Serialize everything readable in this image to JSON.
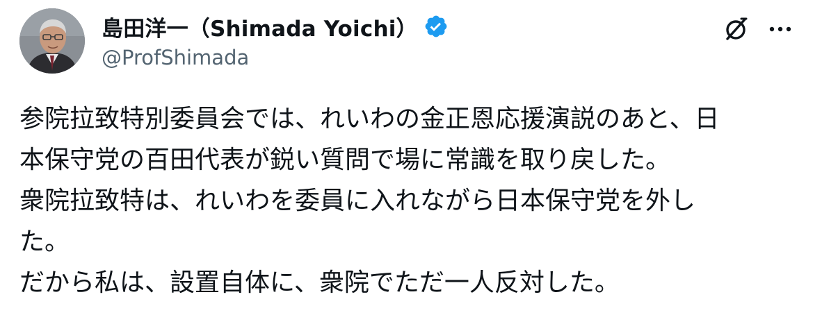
{
  "author": {
    "display_name": "島田洋一（Shimada Yoichi）",
    "handle": "@ProfShimada",
    "verified": true,
    "avatar_icon": "avatar-photo",
    "verified_icon": "verified-badge-icon"
  },
  "actions": {
    "grok_icon": "grok-icon",
    "more_icon": "more-options-icon"
  },
  "colors": {
    "text": "#0f1419",
    "secondary": "#536471",
    "verified": "#1d9bf0"
  },
  "tweet": {
    "lines": [
      "参院拉致特別委員会では、れいわの金正恩応援演説のあと、日",
      "本保守党の百田代表が鋭い質問で場に常識を取り戻した。",
      "衆院拉致特は、れいわを委員に入れながら日本保守党を外し",
      "た。",
      "だから私は、設置自体に、衆院でただ一人反対した。"
    ]
  }
}
